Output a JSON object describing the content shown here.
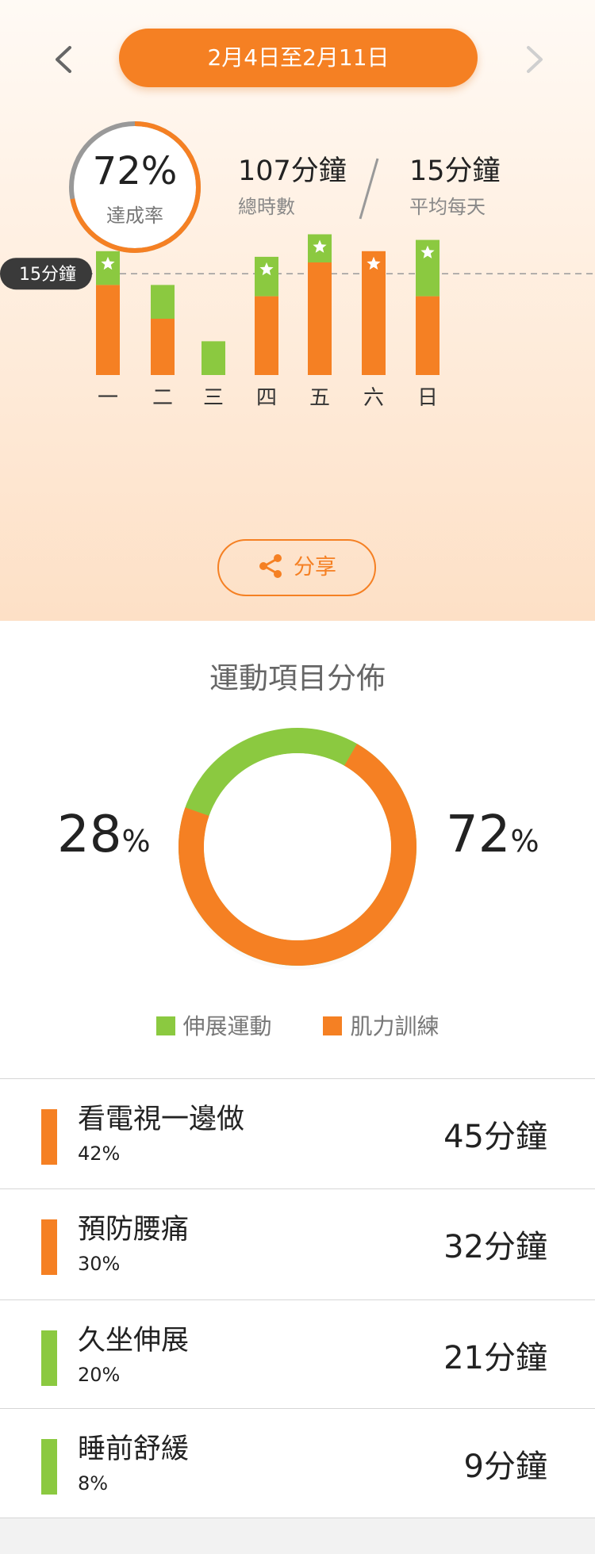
{
  "header": {
    "date_range": "2月4日至2月11日",
    "prev_icon": "chevron-left-icon",
    "next_icon": "chevron-right-icon"
  },
  "summary": {
    "achievement_pct": "72%",
    "achievement_value": 0.72,
    "achievement_label": "達成率",
    "total_value": "107分鐘",
    "total_label": "總時數",
    "avg_value": "15分鐘",
    "avg_label": "平均每天"
  },
  "colors": {
    "orange": "#f58023",
    "green": "#8bc940",
    "ring_gray": "#999999"
  },
  "chart_data": {
    "type": "bar",
    "stacked": true,
    "categories": [
      "一",
      "二",
      "三",
      "四",
      "五",
      "六",
      "日"
    ],
    "series": [
      {
        "values": [
          16,
          10,
          0,
          14,
          20,
          22,
          14
        ],
        "color": "#f58023"
      },
      {
        "values": [
          6,
          6,
          6,
          7,
          5,
          0,
          10
        ],
        "color": "#8bc940"
      }
    ],
    "goal_line": {
      "label": "15分鐘",
      "value": 18
    },
    "goal_met": [
      true,
      false,
      false,
      true,
      true,
      true,
      true
    ],
    "ylim": [
      0,
      24
    ]
  },
  "share": {
    "label": "分享",
    "icon": "share-icon"
  },
  "distribution": {
    "title": "運動項目分佈",
    "stretch_pct": "28",
    "strength_pct": "72",
    "unit": "%",
    "stretch_value": 0.28,
    "strength_value": 0.72,
    "legend": [
      {
        "label": "伸展運動",
        "color": "#8bc940"
      },
      {
        "label": "肌力訓練",
        "color": "#f58023"
      }
    ]
  },
  "activities": [
    {
      "name": "看電視一邊做",
      "pct": "42%",
      "duration": "45分鐘",
      "color": "#f58023"
    },
    {
      "name": "預防腰痛",
      "pct": "30%",
      "duration": "32分鐘",
      "color": "#f58023"
    },
    {
      "name": "久坐伸展",
      "pct": "20%",
      "duration": "21分鐘",
      "color": "#8bc940"
    },
    {
      "name": "睡前舒緩",
      "pct": "8%",
      "duration": "9分鐘",
      "color": "#8bc940"
    }
  ]
}
